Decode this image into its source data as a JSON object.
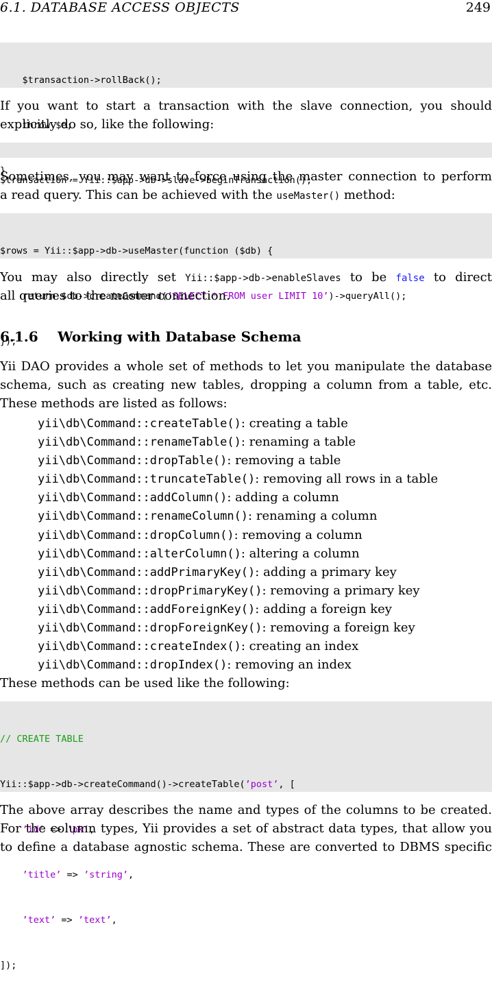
{
  "header": {
    "section": "6.1. DATABASE ACCESS OBJECTS",
    "page": "249"
  },
  "code1": {
    "lines": [
      "    $transaction->rollBack();",
      "    throw $e;",
      "}"
    ]
  },
  "para1": {
    "lines": [
      "If you want to start a transaction with the slave connection, you should",
      "explicitly do so, like the following:"
    ]
  },
  "code2": {
    "lines": [
      "$transaction = Yii::$app->db->slave->beginTransaction();"
    ]
  },
  "para2": {
    "l1": "Sometimes, you may want to force using the master connection to perform",
    "l2a": "a read query. This can be achieved with the ",
    "l2code": "useMaster()",
    "l2b": " method:"
  },
  "code3": {
    "l1": "$rows = Yii::$app->db->useMaster(function ($db) {",
    "l2a": "    return $db->createCommand(",
    "l2str": "’SELECT * FROM user LIMIT 10’",
    "l2b": ")->queryAll();",
    "l3": "});"
  },
  "para3": {
    "l1a": "You may also directly set ",
    "l1code": "Yii::$app->db->enableSlaves",
    "l1b": " to be ",
    "l1false": "false",
    "l1c": " to direct",
    "l2": "all queries to the master connection."
  },
  "heading": {
    "number": "6.1.6",
    "title": "Working with Database Schema"
  },
  "para4": {
    "lines": [
      "Yii DAO provides a whole set of methods to let you manipulate the database",
      "schema, such as creating new tables, dropping a column from a table, etc.",
      "These methods are listed as follows:"
    ]
  },
  "methods": [
    {
      "name": "yii\\db\\Command::createTable()",
      "desc": ": creating a table"
    },
    {
      "name": "yii\\db\\Command::renameTable()",
      "desc": ": renaming a table"
    },
    {
      "name": "yii\\db\\Command::dropTable()",
      "desc": ": removing a table"
    },
    {
      "name": "yii\\db\\Command::truncateTable()",
      "desc": ": removing all rows in a table"
    },
    {
      "name": "yii\\db\\Command::addColumn()",
      "desc": ": adding a column"
    },
    {
      "name": "yii\\db\\Command::renameColumn()",
      "desc": ": renaming a column"
    },
    {
      "name": "yii\\db\\Command::dropColumn()",
      "desc": ": removing a column"
    },
    {
      "name": "yii\\db\\Command::alterColumn()",
      "desc": ": altering a column"
    },
    {
      "name": "yii\\db\\Command::addPrimaryKey()",
      "desc": ": adding a primary key"
    },
    {
      "name": "yii\\db\\Command::dropPrimaryKey()",
      "desc": ": removing a primary key"
    },
    {
      "name": "yii\\db\\Command::addForeignKey()",
      "desc": ": adding a foreign key"
    },
    {
      "name": "yii\\db\\Command::dropForeignKey()",
      "desc": ": removing a foreign key"
    },
    {
      "name": "yii\\db\\Command::createIndex()",
      "desc": ": creating an index"
    },
    {
      "name": "yii\\db\\Command::dropIndex()",
      "desc": ": removing an index"
    }
  ],
  "para5": {
    "text": "These methods can be used like the following:"
  },
  "code4": {
    "comment": "// CREATE TABLE",
    "l2a": "Yii::$app->db->createCommand()->createTable(",
    "l2str": "’post’",
    "l2b": ", [",
    "rows": [
      {
        "k": "’id’",
        "v": "’pk’"
      },
      {
        "k": "’title’",
        "v": "’string’"
      },
      {
        "k": "’text’",
        "v": "’text’"
      }
    ],
    "arrow": " => ",
    "end": "]);"
  },
  "para6": {
    "lines": [
      "The above array describes the name and types of the columns to be created.",
      "For the column types, Yii provides a set of abstract data types, that allow you",
      "to define a database agnostic schema. These are converted to DBMS specific"
    ]
  }
}
